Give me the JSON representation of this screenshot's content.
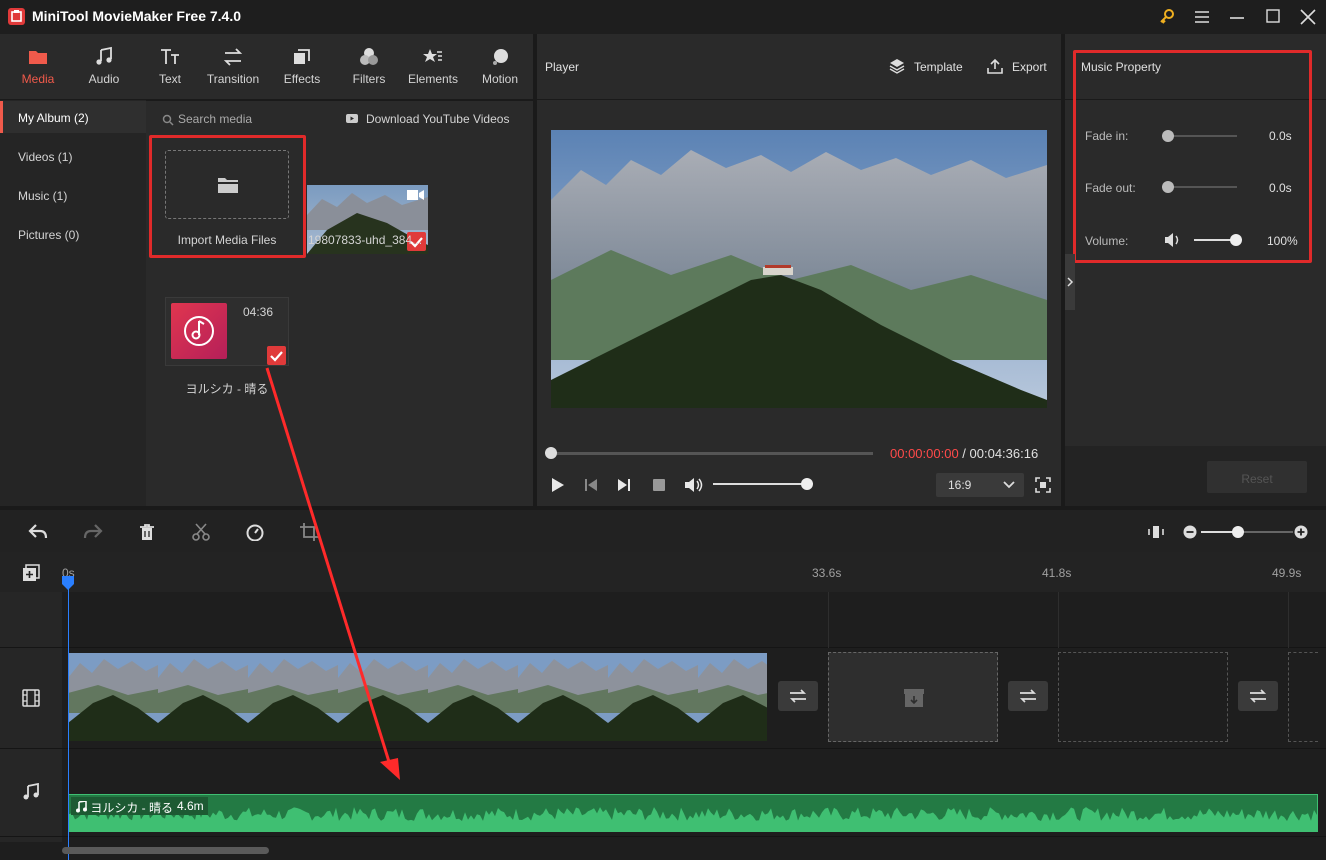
{
  "app": {
    "title": "MiniTool MovieMaker Free 7.4.0"
  },
  "toolbar": [
    {
      "label": "Media",
      "icon": "folder-icon"
    },
    {
      "label": "Audio",
      "icon": "music-note-icon"
    },
    {
      "label": "Text",
      "icon": "text-icon"
    },
    {
      "label": "Transition",
      "icon": "transition-icon"
    },
    {
      "label": "Effects",
      "icon": "effects-icon"
    },
    {
      "label": "Filters",
      "icon": "filters-icon"
    },
    {
      "label": "Elements",
      "icon": "elements-icon"
    },
    {
      "label": "Motion",
      "icon": "motion-icon"
    }
  ],
  "sidebar": {
    "items": [
      {
        "label": "My Album (2)"
      },
      {
        "label": "Videos (1)"
      },
      {
        "label": "Music (1)"
      },
      {
        "label": "Pictures (0)"
      }
    ]
  },
  "media": {
    "search_placeholder": "Search media",
    "download_label": "Download YouTube Videos",
    "import_label": "Import Media Files",
    "video_name": "19807833-uhd_384...",
    "music_duration": "04:36",
    "music_name": "ヨルシカ - 晴る"
  },
  "player": {
    "title": "Player",
    "template_label": "Template",
    "export_label": "Export",
    "current_time": "00:00:00:00",
    "total_time": " / 00:04:36:16",
    "aspect_ratio": "16:9",
    "seek_progress": 0,
    "volume_level": 0.8
  },
  "music_property": {
    "title": "Music Property",
    "fade_in_label": "Fade in:",
    "fade_in_value": "0.0s",
    "fade_out_label": "Fade out:",
    "fade_out_value": "0.0s",
    "volume_label": "Volume:",
    "volume_value": "100%",
    "reset_label": "Reset"
  },
  "timeline": {
    "ruler": [
      "0s",
      "33.6s",
      "41.8s",
      "49.9s"
    ],
    "audio_clip_name": "ヨルシカ - 晴る",
    "audio_clip_duration": "4.6m"
  },
  "colors": {
    "accent": "#f05a4b",
    "highlight": "#e02a2a",
    "audio": "#2e9e5b",
    "playhead": "#2a7fff"
  }
}
